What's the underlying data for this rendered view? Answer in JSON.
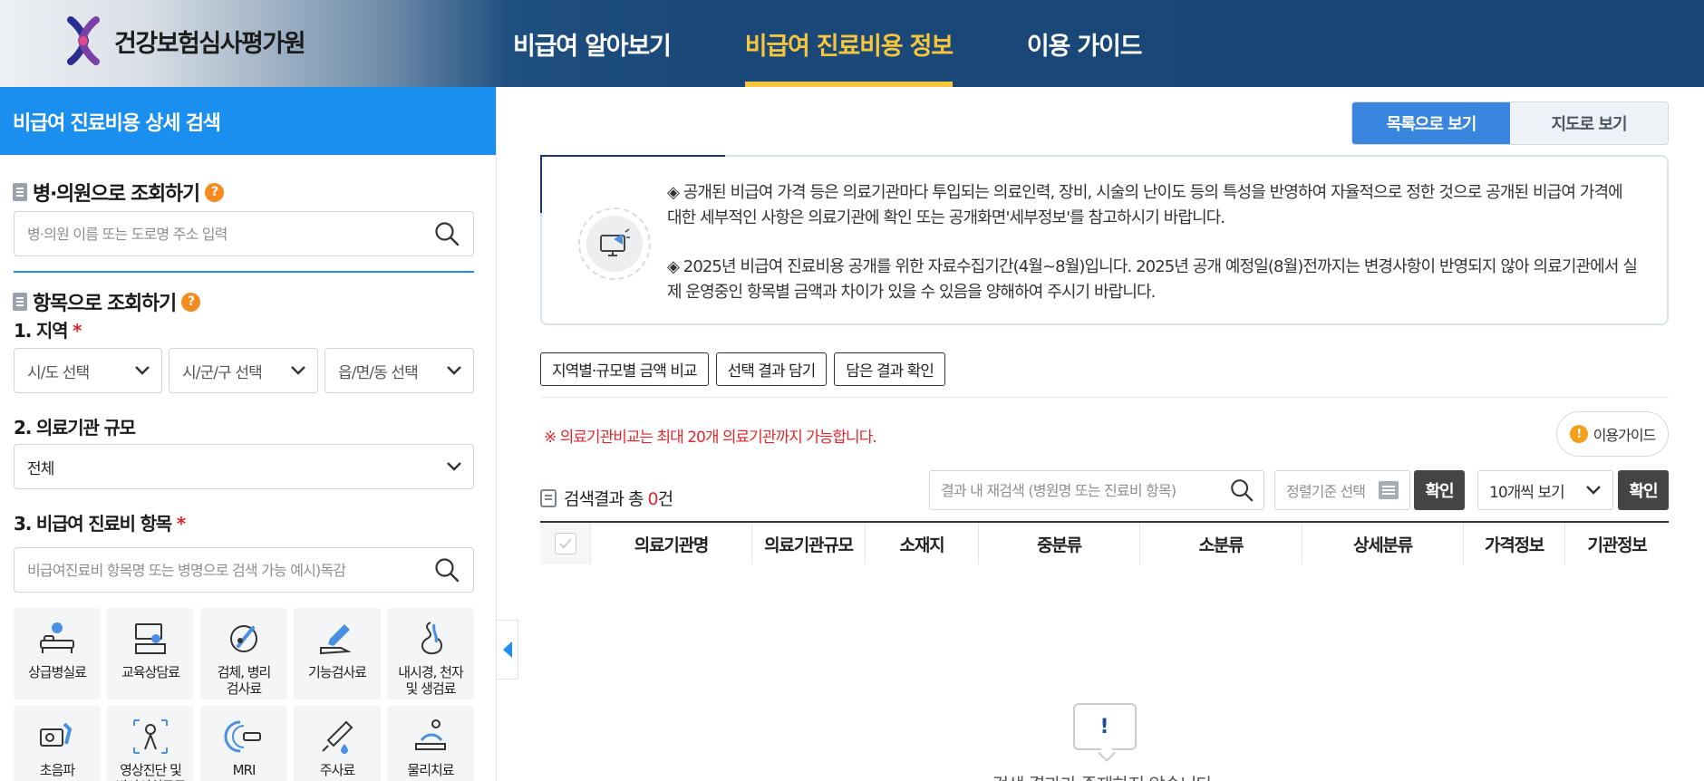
{
  "header": {
    "logo_text": "건강보험심사평가원",
    "nav": [
      {
        "label": "비급여 알아보기",
        "active": false
      },
      {
        "label": "비급여 진료비용 정보",
        "active": true
      },
      {
        "label": "이용 가이드",
        "active": false
      }
    ],
    "active_color": "#f7c63b"
  },
  "sidebar": {
    "title": "비급여 진료비용 상세 검색",
    "hospital_search": {
      "heading": "병·의원으로 조회하기",
      "placeholder": "병·의원 이름 또는 도로명 주소 입력"
    },
    "item_search": {
      "heading": "항목으로 조회하기",
      "region_label": "1. 지역",
      "region_selects": [
        "시/도 선택",
        "시/군/구 선택",
        "읍/면/동 선택"
      ],
      "scale_label": "2. 의료기관 규모",
      "scale_value": "전체",
      "item_label": "3. 비급여 진료비 항목",
      "item_placeholder": "비급여진료비 항목명 또는 병명으로 검색 가능 예시)독감",
      "required_mark": "*"
    },
    "tiles": [
      {
        "label": "상급병실료",
        "icon": "bed-icon"
      },
      {
        "label": "교육상담료",
        "icon": "consultation-icon"
      },
      {
        "label": "검체, 병리\n검사료",
        "icon": "specimen-test-icon"
      },
      {
        "label": "기능검사료",
        "icon": "function-test-icon"
      },
      {
        "label": "내시경, 천자\n및 생검료",
        "icon": "endoscope-icon"
      },
      {
        "label": "초음파",
        "icon": "ultrasound-icon"
      },
      {
        "label": "영상진단 및\n방사선치료료",
        "icon": "xray-icon"
      },
      {
        "label": "MRI",
        "icon": "mri-icon"
      },
      {
        "label": "주사료",
        "icon": "syringe-icon"
      },
      {
        "label": "물리치료",
        "icon": "physical-therapy-icon"
      }
    ],
    "accent": "#1a8ff0"
  },
  "main": {
    "view_toggle": {
      "list": "목록으로 보기",
      "map": "지도로 보기"
    },
    "notice": [
      "◈ 공개된 비급여 가격 등은 의료기관마다 투입되는 의료인력, 장비, 시술의 난이도 등의 특성을 반영하여 자율적으로 정한 것으로 공개된 비급여 가격에 대한 세부적인 사항은 의료기관에 확인 또는 공개화면'세부정보'를 참고하시기 바랍니다.",
      "◈ 2025년 비급여 진료비용 공개를 위한 자료수집기간(4월~8월)입니다. 2025년 공개 예정일(8월)전까지는 변경사항이 반영되지 않아 의료기관에서 실제 운영중인 항목별 금액과 차이가 있을 수 있음을 양해하여 주시기 바랍니다."
    ],
    "buttons": [
      "지역별·규모별 금액 비교",
      "선택 결과 담기",
      "담은 결과 확인"
    ],
    "warning": "※ 의료기관비교는 최대 20개 의료기관까지 가능합니다.",
    "guide_button": "이용가이드",
    "result": {
      "prefix": "검색결과 총 ",
      "count": "0",
      "suffix": "건"
    },
    "result_search_placeholder": "결과 내 재검색 (병원명 또는 진료비 항목)",
    "sort_placeholder": "정렬기준 선택",
    "confirm": "확인",
    "per_page": "10개씩 보기",
    "columns": [
      "의료기관명",
      "의료기관규모",
      "소재지",
      "중분류",
      "소분류",
      "상세분류",
      "가격정보",
      "기관정보"
    ],
    "empty_text": "검색 결과가 존재하지 않습니다."
  }
}
